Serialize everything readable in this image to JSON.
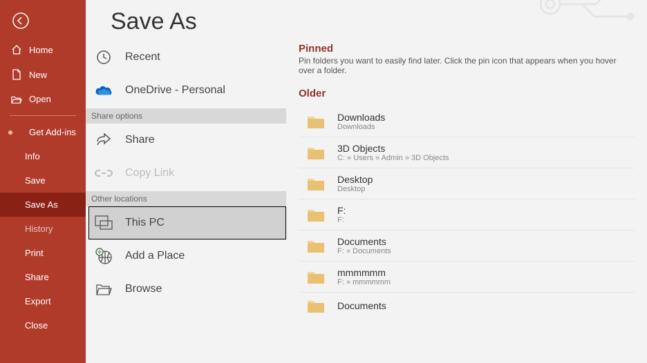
{
  "colors": {
    "brand": "#b03b2b",
    "brand_dark": "#8a2115",
    "accent_text": "#903328"
  },
  "page": {
    "title": "Save As"
  },
  "sidebar": {
    "top": [
      {
        "icon": "home-icon",
        "label": "Home"
      },
      {
        "icon": "new-icon",
        "label": "New"
      },
      {
        "icon": "open-icon",
        "label": "Open"
      }
    ],
    "actions": [
      {
        "label": "Get Add-ins",
        "dot": true
      },
      {
        "label": "Info"
      },
      {
        "label": "Save"
      },
      {
        "label": "Save As",
        "active": true
      },
      {
        "label": "History",
        "faded": true
      },
      {
        "label": "Print"
      },
      {
        "label": "Share"
      },
      {
        "label": "Export"
      },
      {
        "label": "Close"
      }
    ]
  },
  "locations": {
    "top": [
      {
        "icon": "recent-icon",
        "main": "Recent"
      },
      {
        "icon": "onedrive-icon",
        "main": "OneDrive - Personal",
        "sub": " "
      }
    ],
    "share_header": "Share options",
    "share": [
      {
        "icon": "share-icon",
        "main": "Share"
      },
      {
        "icon": "link-icon",
        "main": "Copy Link",
        "disabled": true
      }
    ],
    "other_header": "Other locations",
    "other": [
      {
        "icon": "thispc-icon",
        "main": "This PC",
        "selected": true
      },
      {
        "icon": "addplace-icon",
        "main": "Add a Place"
      },
      {
        "icon": "browse-icon",
        "main": "Browse"
      }
    ]
  },
  "content": {
    "pinned_head": "Pinned",
    "pinned_hint": "Pin folders you want to easily find later. Click the pin icon that appears when you hover over a folder.",
    "older_head": "Older",
    "folders": [
      {
        "name": "Downloads",
        "path": "Downloads"
      },
      {
        "name": "3D Objects",
        "path": "C: » Users » Admin » 3D Objects"
      },
      {
        "name": "Desktop",
        "path": "Desktop"
      },
      {
        "name": "F:",
        "path": "F:"
      },
      {
        "name": "Documents",
        "path": "F: » Documents"
      },
      {
        "name": "mmmmmm",
        "path": "F: » mmmmmm"
      },
      {
        "name": "Documents",
        "path": ""
      }
    ]
  }
}
